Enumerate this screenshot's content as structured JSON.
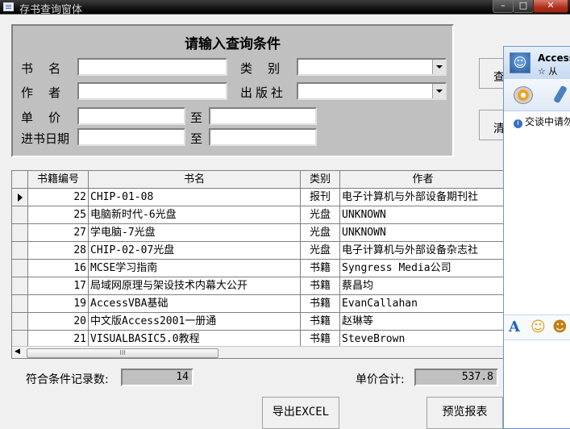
{
  "window": {
    "title": "存书查询窗体",
    "min": "–",
    "max": "□",
    "close": "✕"
  },
  "query": {
    "heading": "请输入查询条件",
    "labels": {
      "book_name": "书    名",
      "category": "类    别",
      "author": "作    者",
      "publisher": "出版社",
      "price": "单    价",
      "date": "进书日期",
      "to1": "至",
      "to2": "至"
    },
    "values": {
      "book_name": "",
      "category": "",
      "author": "",
      "publisher": "",
      "price_from": "",
      "price_to": "",
      "date_from": "",
      "date_to": ""
    }
  },
  "side_buttons": {
    "query": "查",
    "clear": "清"
  },
  "grid": {
    "columns": [
      "书籍编号",
      "书名",
      "类别",
      "作者"
    ],
    "rows": [
      {
        "id": "22",
        "name": "CHIP-01-08",
        "category": "报刊",
        "author": "电子计算机与外部设备期刊社"
      },
      {
        "id": "25",
        "name": "电脑新时代-6光盘",
        "category": "光盘",
        "author": "UNKNOWN"
      },
      {
        "id": "27",
        "name": "学电脑-7光盘",
        "category": "光盘",
        "author": "UNKNOWN"
      },
      {
        "id": "28",
        "name": "CHIP-02-07光盘",
        "category": "光盘",
        "author": "电子计算机与外部设备杂志社"
      },
      {
        "id": "16",
        "name": "MCSE学习指南",
        "category": "书籍",
        "author": "Syngress Media公司"
      },
      {
        "id": "17",
        "name": "局域网原理与架设技术内幕大公开",
        "category": "书籍",
        "author": "蔡昌均"
      },
      {
        "id": "19",
        "name": "AccessVBA基础",
        "category": "书籍",
        "author": "EvanCallahan"
      },
      {
        "id": "20",
        "name": "中文版Access2001一册通",
        "category": "书籍",
        "author": "赵琳等"
      },
      {
        "id": "21",
        "name": "VISUALBASIC5.0教程",
        "category": "书籍",
        "author": "SteveBrown"
      }
    ],
    "scroll_left": "◀",
    "scroll_grip": "III"
  },
  "footer": {
    "count_label": "符合条件记录数:",
    "count_value": "14",
    "sum_label": "单价合计:",
    "sum_value": "537.8"
  },
  "bottom_buttons": {
    "export": "导出EXCEL",
    "preview": "预览报表"
  },
  "chat": {
    "name": "Access",
    "status": "☆ 从",
    "notice": "交谈中请勿",
    "notice_icon": "i"
  }
}
